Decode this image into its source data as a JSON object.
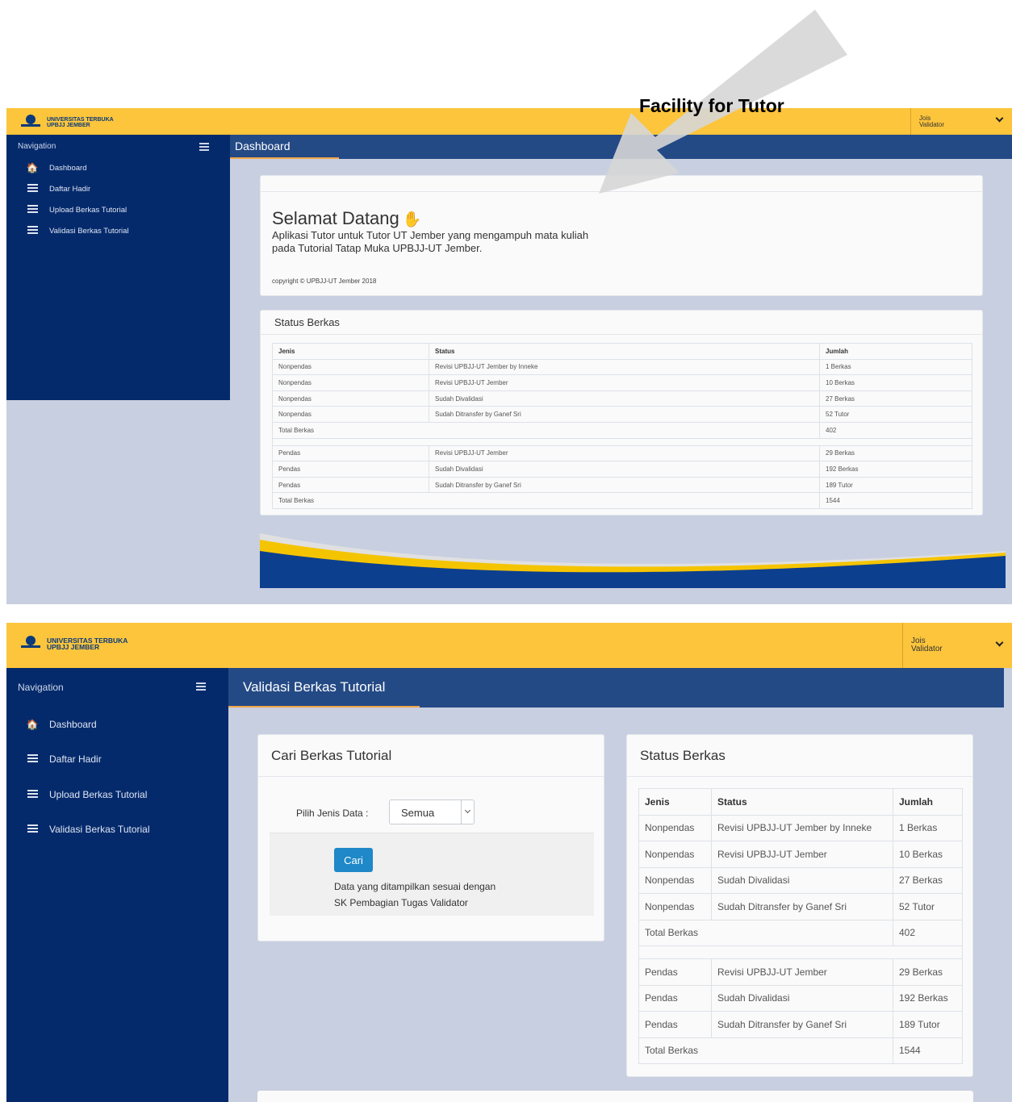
{
  "annotation": "Facility for Tutor",
  "brand": {
    "line1": "UNIVERSITAS TERBUKA",
    "line2": "UPBJJ JEMBER"
  },
  "user": {
    "name": "Jois",
    "role": "Validator"
  },
  "nav": {
    "heading": "Navigation",
    "items": [
      {
        "label": "Dashboard",
        "icon": "home-icon"
      },
      {
        "label": "Daftar Hadir",
        "icon": "list-icon"
      },
      {
        "label": "Upload Berkas Tutorial",
        "icon": "list-icon"
      },
      {
        "label": "Validasi Berkas Tutorial",
        "icon": "list-icon"
      }
    ]
  },
  "shot1": {
    "page_title": "Dashboard",
    "welcome": {
      "title": "Selamat Datang",
      "line1": "Aplikasi Tutor untuk Tutor UT Jember yang mengampuh mata kuliah",
      "line2": "pada Tutorial Tatap Muka UPBJJ-UT Jember.",
      "copyright": "copyright © UPBJJ-UT Jember 2018"
    }
  },
  "shot2": {
    "page_title": "Validasi Berkas Tutorial",
    "search": {
      "title": "Cari Berkas Tutorial",
      "field_label": "Pilih Jenis Data :",
      "selected": "Semua",
      "button": "Cari",
      "note_line1": "Data yang ditampilkan sesuai dengan",
      "note_line2": "SK Pembagian Tugas Validator"
    }
  },
  "status": {
    "title": "Status Berkas",
    "headers": [
      "Jenis",
      "Status",
      "Jumlah"
    ],
    "nonpendas": [
      [
        "Nonpendas",
        "Revisi UPBJJ-UT Jember by Inneke",
        "1 Berkas"
      ],
      [
        "Nonpendas",
        "Revisi UPBJJ-UT Jember",
        "10 Berkas"
      ],
      [
        "Nonpendas",
        "Sudah Divalidasi",
        "27 Berkas"
      ],
      [
        "Nonpendas",
        "Sudah Ditransfer by Ganef Sri",
        "52 Tutor"
      ]
    ],
    "nonpendas_total": [
      "Total Berkas",
      "402"
    ],
    "pendas": [
      [
        "Pendas",
        "Revisi UPBJJ-UT Jember",
        "29 Berkas"
      ],
      [
        "Pendas",
        "Sudah Divalidasi",
        "192 Berkas"
      ],
      [
        "Pendas",
        "Sudah Ditransfer by Ganef Sri",
        "189 Tutor"
      ]
    ],
    "pendas_total": [
      "Total Berkas",
      "1544"
    ]
  },
  "colors": {
    "topbar": "#fcc53c",
    "sidebar": "#052a6c",
    "header": "#244a86",
    "accent": "#f0a64a",
    "button": "#1e88c8"
  }
}
